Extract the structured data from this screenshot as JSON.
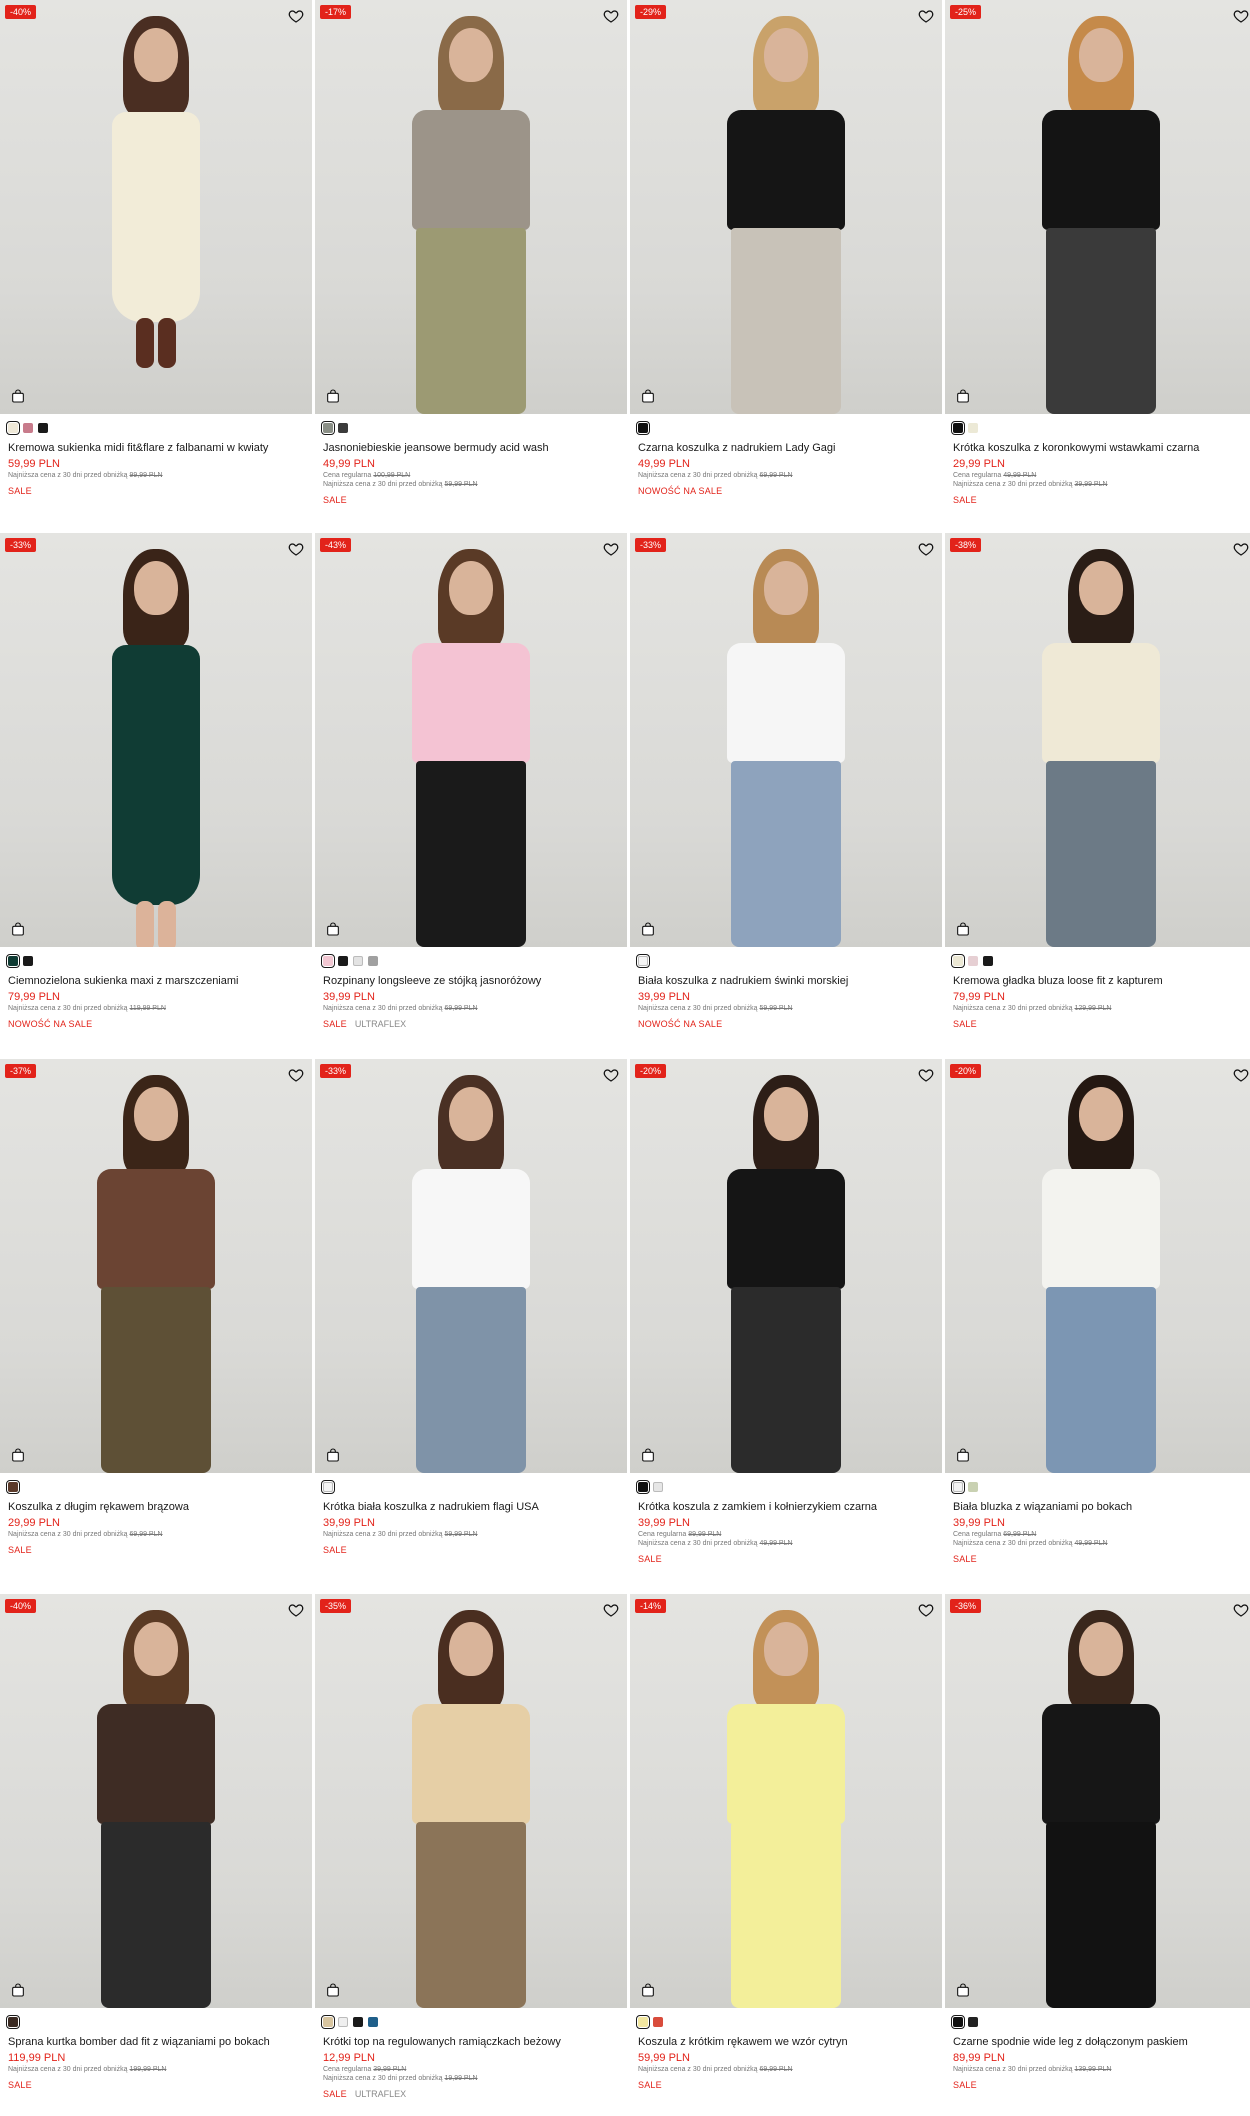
{
  "labels": {
    "lowest_price_prefix": "Najniższa cena z 30 dni przed obniżką",
    "regular_price_prefix": "Cena regularna"
  },
  "products": [
    {
      "discount": "-40%",
      "title": "Kremowa sukienka midi fit&flare z falbanami w kwiaty",
      "price": "59,99 PLN",
      "regular": "",
      "lowest": "99,99 PLN",
      "tags": [
        "SALE"
      ],
      "brand_tag": "",
      "swatches": [
        "#efe9d8",
        "#c87b8b",
        "#1a1a1a"
      ],
      "look": {
        "hair": "#4a2e22",
        "top": "#f2ecd8",
        "bottom": "#f2ecd8",
        "dress": true,
        "boots": "#5a2e20"
      }
    },
    {
      "discount": "-17%",
      "title": "Jasnoniebieskie jeansowe bermudy acid wash",
      "price": "49,99 PLN",
      "regular": "100,99 PLN",
      "lowest": "59,99 PLN",
      "tags": [
        "SALE"
      ],
      "brand_tag": "",
      "swatches": [
        "#8a8f86",
        "#3b3b3b"
      ],
      "look": {
        "hair": "#8a6a48",
        "top": "#9c9489",
        "bottom": "#9c9a73",
        "dress": false,
        "boots": "#222222"
      }
    },
    {
      "discount": "-29%",
      "title": "Czarna koszulka z nadrukiem Lady Gagi",
      "price": "49,99 PLN",
      "regular": "",
      "lowest": "69,99 PLN",
      "tags": [
        "NOWOŚĆ NA SALE"
      ],
      "brand_tag": "",
      "swatches": [
        "#111111"
      ],
      "look": {
        "hair": "#c9a26a",
        "top": "#151515",
        "bottom": "#c8c2b8",
        "dress": false,
        "boots": ""
      }
    },
    {
      "discount": "-25%",
      "title": "Krótka koszulka z koronkowymi wstawkami czarna",
      "price": "29,99 PLN",
      "regular": "49,99 PLN",
      "lowest": "39,99 PLN",
      "tags": [
        "SALE"
      ],
      "brand_tag": "",
      "swatches": [
        "#111111",
        "#ece9d6"
      ],
      "look": {
        "hair": "#c58a4a",
        "top": "#141414",
        "bottom": "#3a3a3a",
        "dress": false,
        "boots": ""
      }
    },
    {
      "discount": "-33%",
      "title": "Ciemnozielona sukienka maxi z marszczeniami",
      "price": "79,99 PLN",
      "regular": "",
      "lowest": "119,99 PLN",
      "tags": [
        "NOWOŚĆ NA SALE"
      ],
      "brand_tag": "",
      "swatches": [
        "#0f3b33",
        "#1a1a1a"
      ],
      "look": {
        "hair": "#3a2418",
        "top": "#103c34",
        "bottom": "#103c34",
        "dress": true,
        "boots": ""
      }
    },
    {
      "discount": "-43%",
      "title": "Rozpinany longsleeve ze stójką jasnoróżowy",
      "price": "39,99 PLN",
      "regular": "",
      "lowest": "69,99 PLN",
      "tags": [
        "SALE"
      ],
      "brand_tag": "ULTRAFLEX",
      "swatches": [
        "#f2c7d2",
        "#1a1a1a",
        "#e3e3e3",
        "#a0a0a0"
      ],
      "look": {
        "hair": "#5a3a26",
        "top": "#f4c3d3",
        "bottom": "#1a1a1a",
        "dress": false,
        "boots": ""
      }
    },
    {
      "discount": "-33%",
      "title": "Biała koszulka z nadrukiem świnki morskiej",
      "price": "39,99 PLN",
      "regular": "",
      "lowest": "59,99 PLN",
      "tags": [
        "NOWOŚĆ NA SALE"
      ],
      "brand_tag": "",
      "swatches": [
        "#f5f5f5"
      ],
      "look": {
        "hair": "#b88a55",
        "top": "#f6f6f6",
        "bottom": "#8ea3bd",
        "dress": false,
        "boots": ""
      }
    },
    {
      "discount": "-38%",
      "title": "Kremowa gładka bluza loose fit z kapturem",
      "price": "79,99 PLN",
      "regular": "",
      "lowest": "129,99 PLN",
      "tags": [
        "SALE"
      ],
      "brand_tag": "",
      "swatches": [
        "#ece8d4",
        "#e6cfd3",
        "#1a1a1a"
      ],
      "look": {
        "hair": "#2a1d16",
        "top": "#efe9d6",
        "bottom": "#6c7a86",
        "dress": false,
        "boots": ""
      }
    },
    {
      "discount": "-37%",
      "title": "Koszulka z długim rękawem brązowa",
      "price": "29,99 PLN",
      "regular": "",
      "lowest": "69,99 PLN",
      "tags": [
        "SALE"
      ],
      "brand_tag": "",
      "swatches": [
        "#5b3a2a"
      ],
      "look": {
        "hair": "#3b2518",
        "top": "#6b4433",
        "bottom": "#5e5036",
        "dress": false,
        "boots": ""
      }
    },
    {
      "discount": "-33%",
      "title": "Krótka biała koszulka z nadrukiem flagi USA",
      "price": "39,99 PLN",
      "regular": "",
      "lowest": "59,99 PLN",
      "tags": [
        "SALE"
      ],
      "brand_tag": "",
      "swatches": [
        "#f5f5f5"
      ],
      "look": {
        "hair": "#4a3024",
        "top": "#f7f7f7",
        "bottom": "#7f93a8",
        "dress": false,
        "boots": ""
      }
    },
    {
      "discount": "-20%",
      "title": "Krótka koszula z zamkiem i kołnierzykiem czarna",
      "price": "39,99 PLN",
      "regular": "89,99 PLN",
      "lowest": "49,99 PLN",
      "tags": [
        "SALE"
      ],
      "brand_tag": "",
      "swatches": [
        "#111111",
        "#e6e6e6"
      ],
      "look": {
        "hair": "#2d1e17",
        "top": "#151515",
        "bottom": "#2b2b2b",
        "dress": false,
        "boots": ""
      }
    },
    {
      "discount": "-20%",
      "title": "Biała bluzka z wiązaniami po bokach",
      "price": "39,99 PLN",
      "regular": "69,99 PLN",
      "lowest": "49,99 PLN",
      "tags": [
        "SALE"
      ],
      "brand_tag": "",
      "swatches": [
        "#f3f3f3",
        "#c9d1b2"
      ],
      "look": {
        "hair": "#241812",
        "top": "#f3f3ef",
        "bottom": "#7c96b3",
        "dress": false,
        "boots": ""
      }
    },
    {
      "discount": "-40%",
      "title": "Sprana kurtka bomber dad fit z wiązaniami po bokach",
      "price": "119,99 PLN",
      "regular": "",
      "lowest": "199,99 PLN",
      "tags": [
        "SALE"
      ],
      "brand_tag": "",
      "swatches": [
        "#3a2a22"
      ],
      "look": {
        "hair": "#5a3a24",
        "top": "#3e2c24",
        "bottom": "#2b2b2b",
        "dress": false,
        "boots": ""
      }
    },
    {
      "discount": "-35%",
      "title": "Krótki top na regulowanych ramiączkach beżowy",
      "price": "12,99 PLN",
      "regular": "39,99 PLN",
      "lowest": "19,99 PLN",
      "tags": [
        "SALE"
      ],
      "brand_tag": "ULTRAFLEX",
      "swatches": [
        "#d8c59f",
        "#efefef",
        "#1a1a1a",
        "#1f5f8a"
      ],
      "look": {
        "hair": "#4a2e20",
        "top": "#e6cfa6",
        "bottom": "#8b7458",
        "dress": false,
        "boots": ""
      }
    },
    {
      "discount": "-14%",
      "title": "Koszula z krótkim rękawem we wzór cytryn",
      "price": "59,99 PLN",
      "regular": "",
      "lowest": "69,99 PLN",
      "tags": [
        "SALE"
      ],
      "brand_tag": "",
      "swatches": [
        "#f2e7a0",
        "#d94c3c"
      ],
      "look": {
        "hair": "#c29158",
        "top": "#f3ef9a",
        "bottom": "#f3ef9a",
        "dress": false,
        "boots": ""
      }
    },
    {
      "discount": "-36%",
      "title": "Czarne spodnie wide leg z dołączonym paskiem",
      "price": "89,99 PLN",
      "regular": "",
      "lowest": "139,99 PLN",
      "tags": [
        "SALE"
      ],
      "brand_tag": "",
      "swatches": [
        "#111111",
        "#222222"
      ],
      "look": {
        "hair": "#3a271c",
        "top": "#161616",
        "bottom": "#121212",
        "dress": false,
        "boots": ""
      }
    }
  ]
}
